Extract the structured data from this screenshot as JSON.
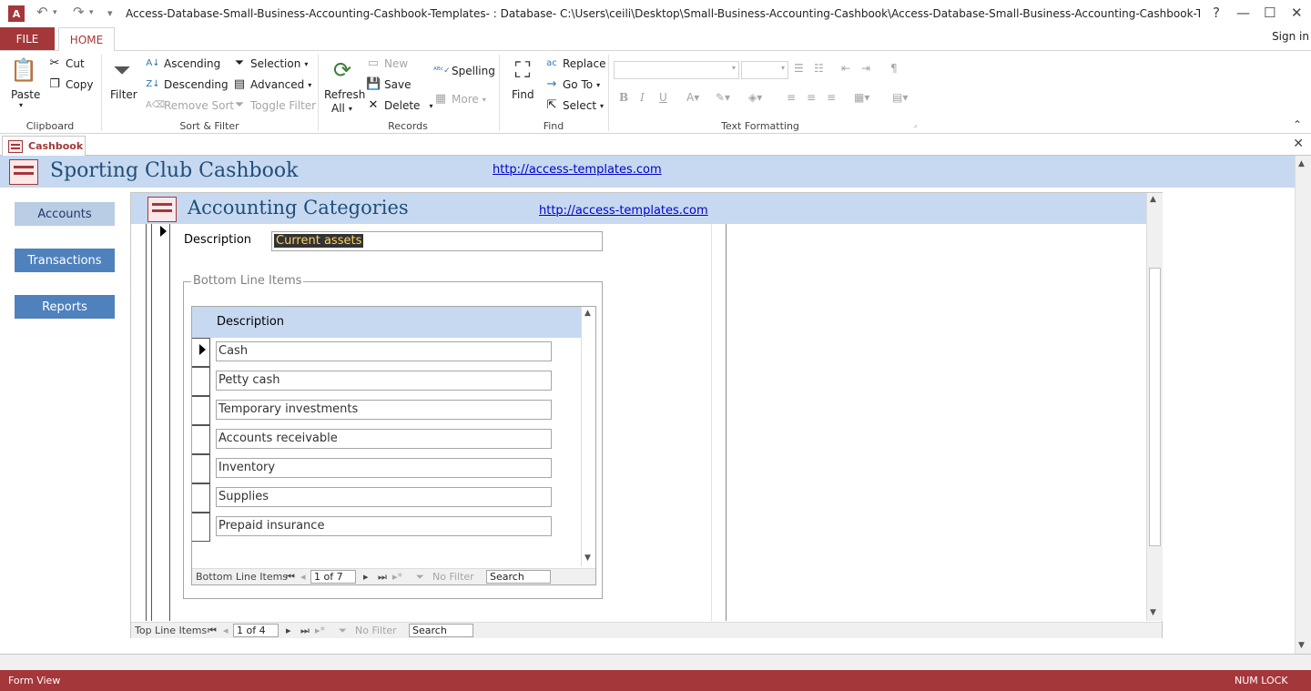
{
  "window": {
    "title": "Access-Database-Small-Business-Accounting-Cashbook-Templates- : Database- C:\\Users\\ceili\\Desktop\\Small-Business-Accounting-Cashbook\\Access-Database-Small-Business-Accounting-Cashbook-Templates-.accdb (...",
    "app_icon": "A",
    "help": "?",
    "minimize": "—",
    "restore": "☐",
    "close": "✕",
    "undo": "↶",
    "redo": "↷",
    "customize": "▾"
  },
  "ribbon_tabs": {
    "file": "FILE",
    "home": "HOME",
    "signin": "Sign in"
  },
  "ribbon": {
    "clipboard": {
      "label": "Clipboard",
      "paste": "Paste",
      "cut": "Cut",
      "copy": "Copy"
    },
    "sort_filter": {
      "label": "Sort & Filter",
      "filter": "Filter",
      "ascending": "Ascending",
      "descending": "Descending",
      "remove_sort": "Remove Sort",
      "selection": "Selection",
      "advanced": "Advanced",
      "toggle_filter": "Toggle Filter"
    },
    "records": {
      "label": "Records",
      "refresh": "Refresh",
      "refresh_all": "All",
      "new": "New",
      "save": "Save",
      "delete": "Delete",
      "spelling": "Spelling",
      "more": "More"
    },
    "find": {
      "label": "Find",
      "find": "Find",
      "replace": "Replace",
      "goto": "Go To",
      "select": "Select"
    },
    "text_formatting": {
      "label": "Text Formatting",
      "bold": "B",
      "italic": "I",
      "underline": "U"
    }
  },
  "doc_tab": {
    "label": "Cashbook",
    "close": "✕"
  },
  "main": {
    "title": "Sporting Club Cashbook",
    "link": "http://access-templates.com",
    "nav": [
      {
        "label": "Accounts",
        "color": "#b9cde5",
        "text_color": "#1f3864"
      },
      {
        "label": "Transactions",
        "color": "#4f81bd",
        "text_color": "#ffffff"
      },
      {
        "label": "Reports",
        "color": "#4f81bd",
        "text_color": "#ffffff"
      }
    ]
  },
  "subform": {
    "title": "Accounting Categories",
    "link": "http://access-templates.com",
    "description_label": "Description",
    "description_value": "Current assets",
    "group_title": "Bottom Line Items",
    "column_header": "Description",
    "rows": [
      "Cash",
      "Petty cash",
      "Temporary investments",
      "Accounts receivable",
      "Inventory",
      "Supplies",
      "Prepaid insurance"
    ],
    "inner_nav": {
      "label": "Bottom Line Items",
      "record": "1 of 7",
      "filter": "No Filter",
      "search": "Search"
    },
    "outer_nav": {
      "label": "Top Line Items",
      "record": "1 of 4",
      "filter": "No Filter",
      "search": "Search"
    }
  },
  "status": {
    "left": "Form View",
    "right": "NUM LOCK"
  },
  "colors": {
    "accent": "#a4373a",
    "header_band": "#c7d9f0",
    "title_text": "#1f4e79"
  }
}
